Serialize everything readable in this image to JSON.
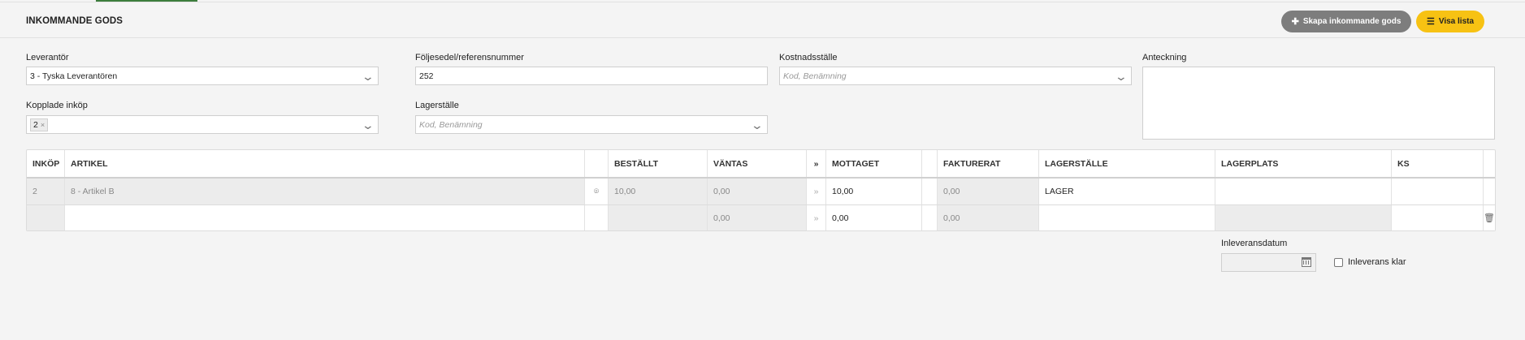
{
  "header": {
    "title": "INKOMMANDE GODS",
    "create_button": "Skapa inkommande gods",
    "create_icon": "plus-icon",
    "list_button": "Visa lista",
    "list_icon": "list-icon"
  },
  "form": {
    "supplier": {
      "label": "Leverantör",
      "value": "3 - Tyska Leverantören"
    },
    "delivery_note": {
      "label": "Följesedel/referensnummer",
      "value": "252"
    },
    "cost_center": {
      "label": "Kostnadsställe",
      "placeholder": "Kod, Benämning"
    },
    "note": {
      "label": "Anteckning",
      "value": ""
    },
    "linked_purchases": {
      "label": "Kopplade inköp",
      "tag": "2",
      "tag_remove": "×"
    },
    "warehouse": {
      "label": "Lagerställe",
      "placeholder": "Kod, Benämning"
    }
  },
  "grid": {
    "columns": [
      "INKÖP",
      "ARTIKEL",
      "",
      "BESTÄLLT",
      "VÄNTAS",
      "»",
      "MOTTAGET",
      "",
      "FAKTURERAT",
      "LAGERSTÄLLE",
      "LAGERPLATS",
      "KS",
      ""
    ],
    "rows": [
      {
        "inkop": "2",
        "artikel": "8 - Artikel B",
        "bestallt": "10,00",
        "vantas": "0,00",
        "arrow": "»",
        "mottaget": "10,00",
        "fakturerat": "0,00",
        "lagerstalle": "LAGER",
        "lagerplats": "",
        "ks": ""
      },
      {
        "inkop": "",
        "artikel": "",
        "bestallt": "",
        "vantas": "0,00",
        "arrow": "»",
        "mottaget": "0,00",
        "fakturerat": "0,00",
        "lagerstalle": "",
        "lagerplats": "",
        "ks": ""
      }
    ]
  },
  "footer": {
    "date_label": "Inleveransdatum",
    "date_value": "",
    "done_label": "Inleverans klar"
  },
  "colors": {
    "accent_yellow": "#f7c213",
    "button_gray": "#7d7d7d",
    "top_accent": "#3c7d3c"
  }
}
